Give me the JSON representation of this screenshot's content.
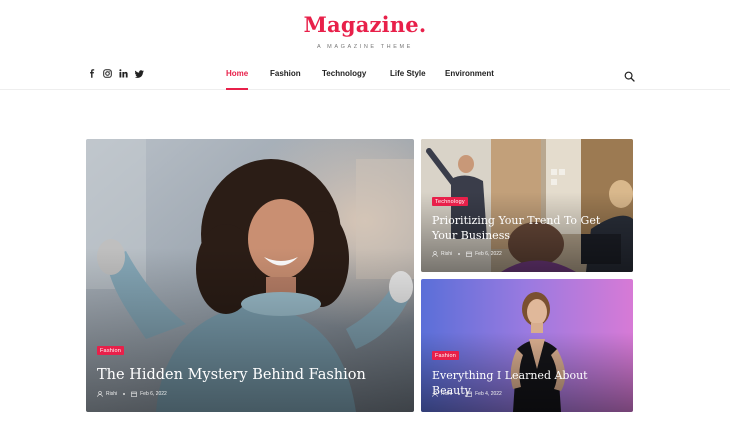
{
  "site": {
    "logo": "Magazine.",
    "tagline": "A MAGAZINE THEME",
    "brand_color": "#e8204a"
  },
  "socials": [
    {
      "icon": "facebook-icon",
      "glyph": "f"
    },
    {
      "icon": "instagram-icon",
      "glyph": "◎"
    },
    {
      "icon": "linkedin-icon",
      "glyph": "in"
    },
    {
      "icon": "twitter-icon",
      "glyph": "🐦"
    }
  ],
  "nav": {
    "items": [
      {
        "label": "Home",
        "active": true
      },
      {
        "label": "Fashion",
        "active": false
      },
      {
        "label": "Technology",
        "active": false
      },
      {
        "label": "Life Style",
        "active": false
      },
      {
        "label": "Environment",
        "active": false
      }
    ],
    "search_icon": "search-icon"
  },
  "posts": {
    "main": {
      "category": "Fashion",
      "title": "The Hidden Mystery Behind Fashion",
      "author": "Rishi",
      "date": "Feb 6, 2022"
    },
    "top_right": {
      "category": "Technology",
      "title": "Prioritizing Your Trend To Get Your Business",
      "author": "Rishi",
      "date": "Feb 6, 2022"
    },
    "bottom_right": {
      "category": "Fashion",
      "title": "Everything I Learned About Beauty",
      "author": "Rishi",
      "date": "Feb 4, 2022"
    }
  }
}
